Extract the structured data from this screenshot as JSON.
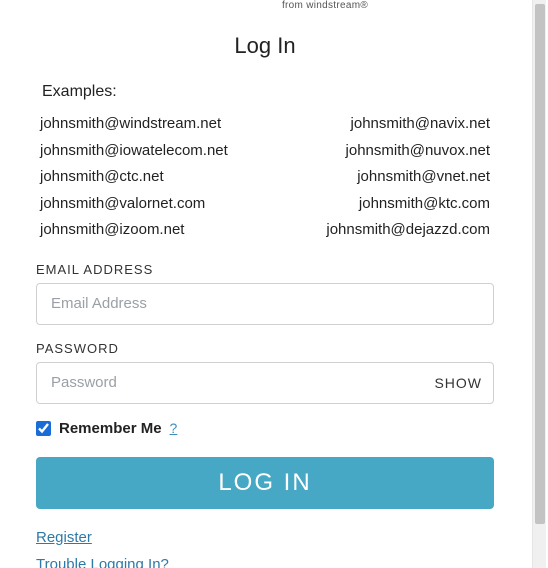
{
  "brand_tag": "from windstream®",
  "title": "Log In",
  "examples_label": "Examples:",
  "examples_left": [
    "johnsmith@windstream.net",
    "johnsmith@iowatelecom.net",
    "johnsmith@ctc.net",
    "johnsmith@valornet.com",
    "johnsmith@izoom.net"
  ],
  "examples_right": [
    "johnsmith@navix.net",
    "johnsmith@nuvox.net",
    "johnsmith@vnet.net",
    "johnsmith@ktc.com",
    "johnsmith@dejazzd.com"
  ],
  "email": {
    "label": "EMAIL ADDRESS",
    "placeholder": "Email Address",
    "value": ""
  },
  "password": {
    "label": "PASSWORD",
    "placeholder": "Password",
    "value": "",
    "show_label": "SHOW"
  },
  "remember": {
    "label": "Remember Me",
    "checked": true,
    "help": "?"
  },
  "login_button": "LOG IN",
  "links": {
    "register": "Register",
    "trouble": "Trouble Logging In?"
  }
}
